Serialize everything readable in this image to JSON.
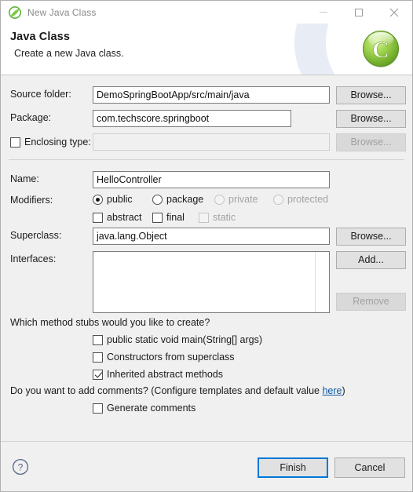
{
  "window": {
    "title": "New Java Class",
    "icon": "spring-leaf-icon",
    "controls": {
      "minimize": "minimize-icon",
      "maximize": "maximize-icon",
      "close": "close-icon"
    }
  },
  "banner": {
    "heading": "Java Class",
    "description": "Create a new Java class.",
    "logo": "java-class-wizard-icon",
    "accent_color": "#7dc242"
  },
  "form": {
    "source_folder": {
      "label": "Source folder:",
      "value": "DemoSpringBootApp/src/main/java",
      "browse": "Browse..."
    },
    "package": {
      "label": "Package:",
      "value": "com.techscore.springboot",
      "browse": "Browse..."
    },
    "enclosing_type": {
      "label": "Enclosing type:",
      "value": "",
      "checked": false,
      "enabled": false,
      "browse": "Browse..."
    },
    "name": {
      "label": "Name:",
      "value": "HelloController"
    },
    "modifiers": {
      "label": "Modifiers:",
      "radios": [
        {
          "label": "public",
          "selected": true,
          "enabled": true
        },
        {
          "label": "package",
          "selected": false,
          "enabled": true
        },
        {
          "label": "private",
          "selected": false,
          "enabled": false
        },
        {
          "label": "protected",
          "selected": false,
          "enabled": false
        }
      ],
      "checkboxes": [
        {
          "label": "abstract",
          "checked": false,
          "enabled": true
        },
        {
          "label": "final",
          "checked": false,
          "enabled": true
        },
        {
          "label": "static",
          "checked": false,
          "enabled": false
        }
      ]
    },
    "superclass": {
      "label": "Superclass:",
      "value": "java.lang.Object",
      "browse": "Browse..."
    },
    "interfaces": {
      "label": "Interfaces:",
      "items": [],
      "add": "Add...",
      "remove": "Remove"
    }
  },
  "stubs": {
    "question": "Which method stubs would you like to create?",
    "options": [
      {
        "label": "public static void main(String[] args)",
        "checked": false
      },
      {
        "label": "Constructors from superclass",
        "checked": false
      },
      {
        "label": "Inherited abstract methods",
        "checked": true
      }
    ]
  },
  "comments": {
    "question_prefix": "Do you want to add comments? (Configure templates and default value ",
    "link": "here",
    "question_suffix": ")",
    "option": {
      "label": "Generate comments",
      "checked": false
    }
  },
  "footer": {
    "help": "help-icon",
    "finish": "Finish",
    "cancel": "Cancel"
  }
}
